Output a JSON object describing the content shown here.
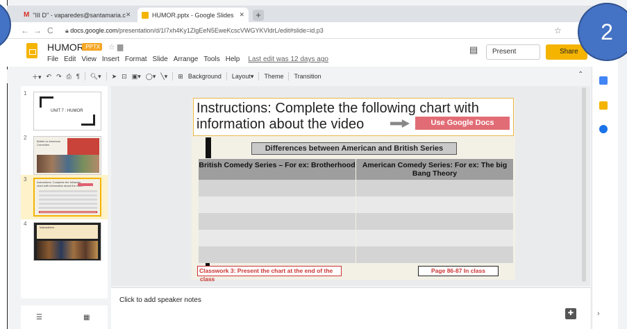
{
  "browser": {
    "tabs": [
      {
        "label": "\"III D\" - vaparedes@santamaria.c",
        "favicon": "gmail-icon"
      },
      {
        "label": "HUMOR.pptx - Google Slides",
        "favicon": "slides-icon"
      }
    ],
    "url_prefix": "docs.google.com",
    "url_rest": "/presentation/d/1I7xh4Ky1ZlgEeN5EweKcscVWGYKVldrL/edit#slide=id.p3"
  },
  "app": {
    "doc_title": "HUMOR",
    "badge": ".PPTX",
    "menus": [
      "File",
      "Edit",
      "View",
      "Insert",
      "Format",
      "Slide",
      "Arrange",
      "Tools",
      "Help"
    ],
    "last_edit": "Last edit was 12 days ago",
    "present_label": "Present",
    "share_label": "Share"
  },
  "toolbar": {
    "background": "Background",
    "layout": "Layout",
    "theme": "Theme",
    "transition": "Transition"
  },
  "filmstrip": {
    "slides": [
      {
        "num": "1",
        "title": "UNIT 7 : HUMOR"
      },
      {
        "num": "2",
        "title": "British vs American Comedies"
      },
      {
        "num": "3",
        "title": "Instructions: Complete the following chart with information about the video"
      },
      {
        "num": "4",
        "title": "Instructions:"
      }
    ]
  },
  "slide": {
    "instructions": "Instructions: Complete the following chart with information about the video",
    "google_docs_button": "Use Google Docs",
    "diff_title": "Differences between American and British Series",
    "table": {
      "headers": [
        "British  Comedy Series – For ex: Brotherhood",
        "American Comedy Series: For ex: The big Bang Theory"
      ],
      "rows": 5
    },
    "classwork": "Classwork 3: Present the chart at the end of the",
    "classwork_cont": "class",
    "pages": "Page 86-87 In class"
  },
  "notes": {
    "placeholder": "Click to add speaker notes"
  },
  "overlay": {
    "badge_number": "2",
    "badge_color": "#4472c4"
  },
  "colors": {
    "accent_yellow": "#f4b400",
    "button_pink": "#e26c75",
    "classwork_red": "#cc3333"
  }
}
